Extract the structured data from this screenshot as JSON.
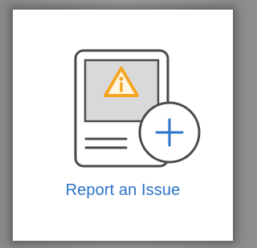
{
  "tile": {
    "label": "Report an Issue",
    "icons": {
      "document": "document-icon",
      "warning": "warning-icon",
      "add": "add-icon"
    },
    "colors": {
      "label": "#2b73c8",
      "warning": "#f5a623",
      "plus": "#2b73c8",
      "outline": "#4a4a4a",
      "screen": "#d9d9d9"
    }
  }
}
